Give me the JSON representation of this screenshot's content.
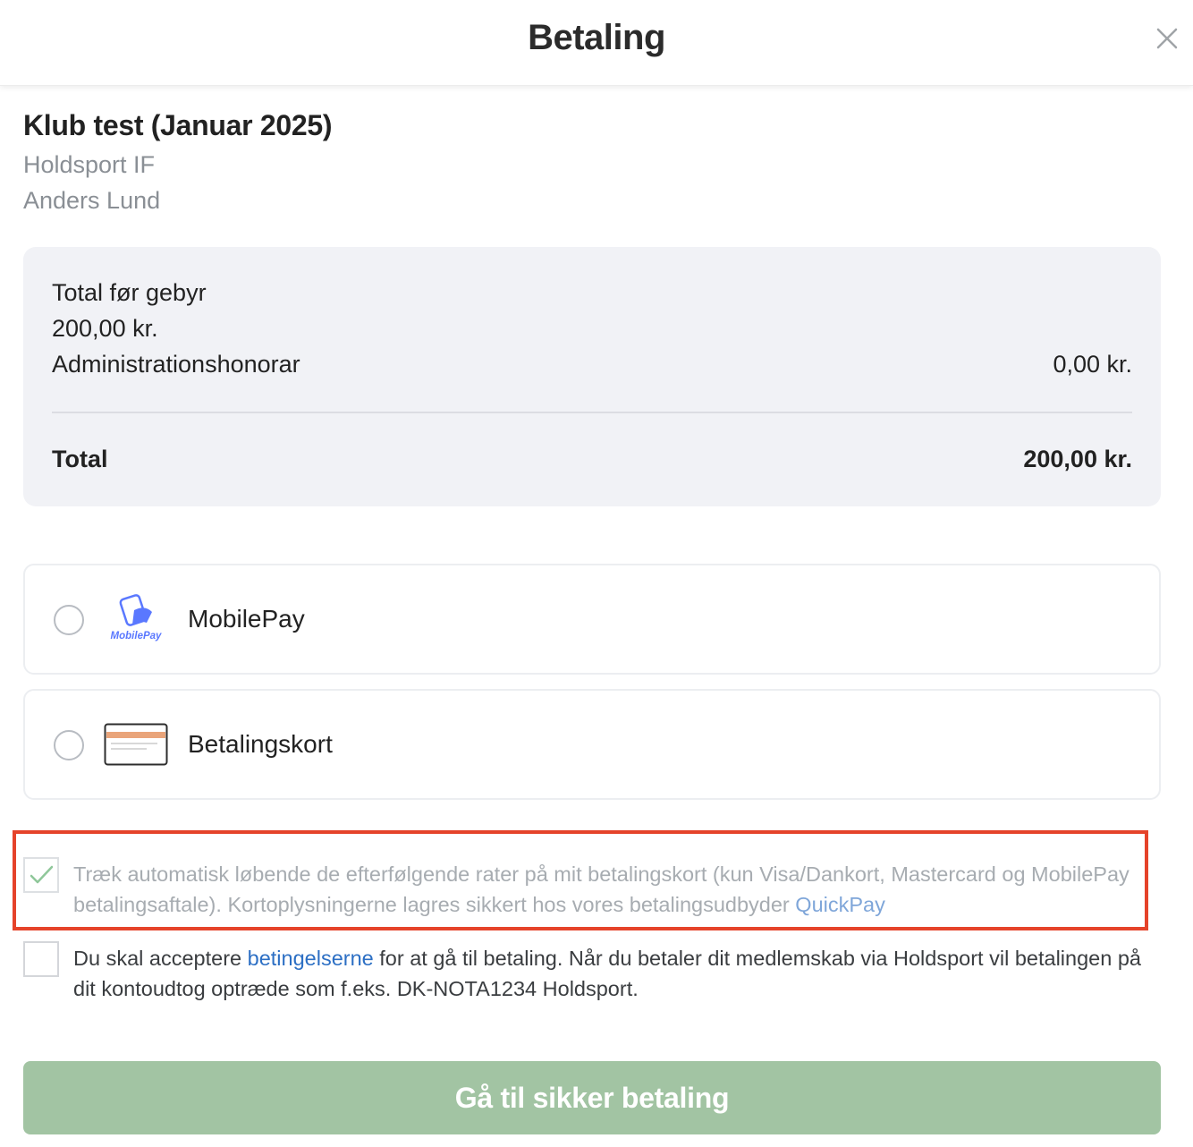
{
  "header": {
    "title": "Betaling",
    "close_icon": "close-icon"
  },
  "club": {
    "title": "Klub test (Januar 2025)",
    "organization": "Holdsport IF",
    "member": "Anders Lund"
  },
  "summary": {
    "subtotal_label": "Total før gebyr",
    "subtotal_value": "200,00 kr.",
    "fee_label": "Administrationshonorar",
    "fee_value": "0,00 kr.",
    "total_label": "Total",
    "total_value": "200,00 kr."
  },
  "payment_methods": [
    {
      "label": "MobilePay",
      "icon": "mobilepay-logo-icon",
      "logo_text": "MobilePay",
      "selected": false
    },
    {
      "label": "Betalingskort",
      "icon": "credit-card-icon",
      "selected": false
    }
  ],
  "auto_charge": {
    "checked": true,
    "text": "Træk automatisk løbende de efterfølgende rater på mit betalingskort (kun Visa/Dankort, Mastercard og MobilePay betalingsaftale). Kortoplysningerne lagres sikkert hos vores betalingsudbyder",
    "link_text": "QuickPay"
  },
  "terms": {
    "checked": false,
    "text_before": "Du skal acceptere",
    "link_text": "betingelserne",
    "text_after": "for at gå til betaling. Når du betaler dit medlemskab via Holdsport vil betalingen på dit kontoudtog optræde som f.eks. DK-NOTA1234 Holdsport."
  },
  "cta": {
    "label": "Gå til sikker betaling"
  },
  "colors": {
    "cta_background": "#a2c4a3",
    "highlight_border": "#e5432a",
    "link": "#2c6fc4",
    "summary_background": "#f1f2f6",
    "mobilepay_brand": "#5a78ff"
  }
}
